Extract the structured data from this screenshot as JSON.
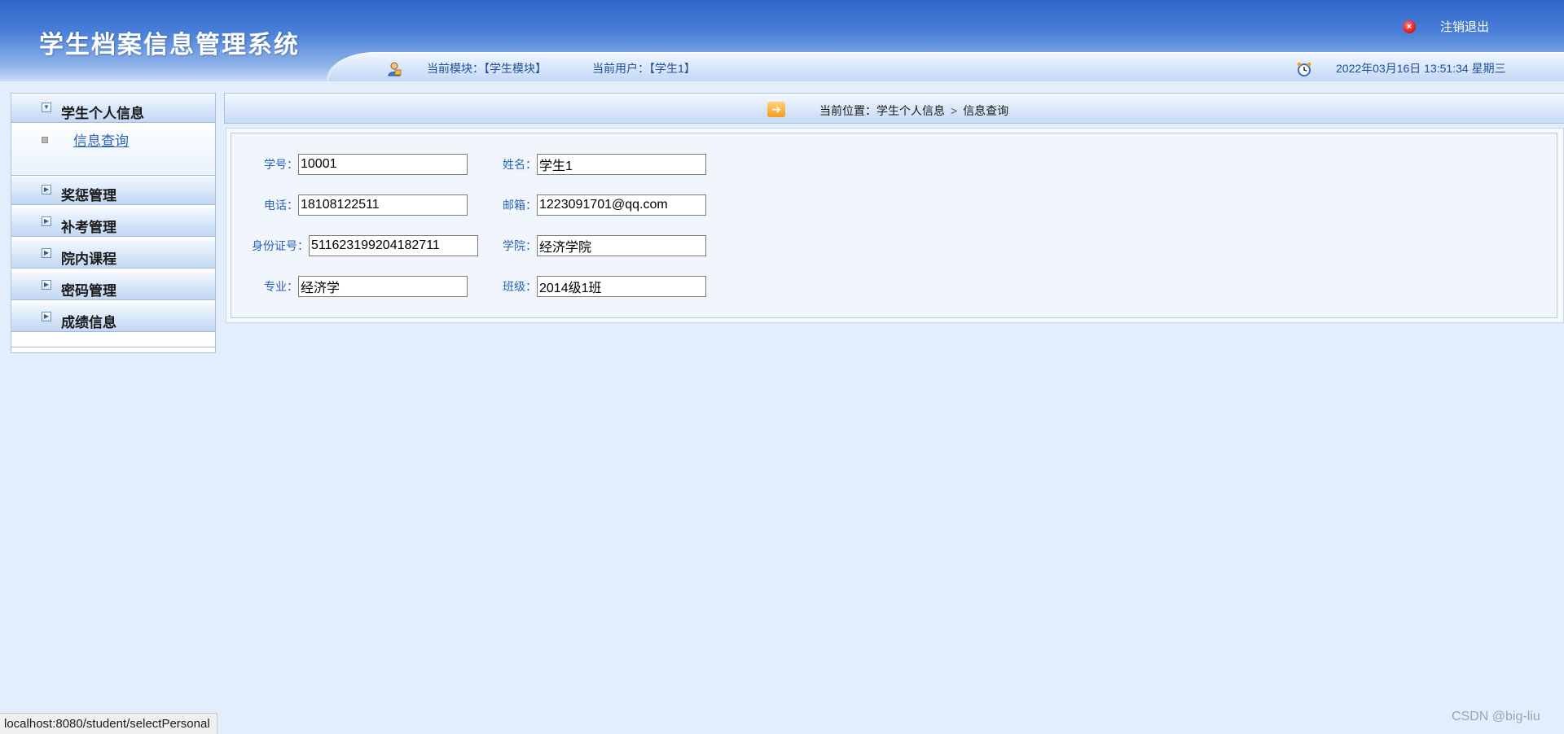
{
  "header": {
    "title": "学生档案信息管理系统",
    "logout_label": "注销退出",
    "module_text": "当前模块：【学生模块】",
    "user_text": "当前用户：【学生1】",
    "datetime_text": "2022年03月16日 13:51:34 星期三"
  },
  "sidebar": {
    "groups": [
      {
        "label": "学生个人信息",
        "expanded": true,
        "items": [
          {
            "label": "信息查询"
          }
        ]
      },
      {
        "label": "奖惩管理",
        "expanded": false
      },
      {
        "label": "补考管理",
        "expanded": false
      },
      {
        "label": "院内课程",
        "expanded": false
      },
      {
        "label": "密码管理",
        "expanded": false
      },
      {
        "label": "成绩信息",
        "expanded": false
      }
    ]
  },
  "breadcrumb": {
    "prefix": "当前位置：学生个人信息",
    "separator": ">",
    "current": "信息查询"
  },
  "form": {
    "student_id": {
      "label": "学号：",
      "value": "10001"
    },
    "name": {
      "label": "姓名：",
      "value": "学生1"
    },
    "phone": {
      "label": "电话：",
      "value": "18108122511"
    },
    "email": {
      "label": "邮箱：",
      "value": "1223091701@qq.com"
    },
    "id_card": {
      "label": "身份证号：",
      "value": "511623199204182711"
    },
    "college": {
      "label": "学院：",
      "value": "经济学院"
    },
    "major": {
      "label": "专业：",
      "value": "经济学"
    },
    "class_name": {
      "label": "班级：",
      "value": "2014级1班"
    }
  },
  "status_bar": {
    "url": "localhost:8080/student/selectPersonal"
  },
  "watermark": "CSDN @big-liu",
  "colors": {
    "header_blue": "#2f66c9",
    "page_background": "#e2eefc",
    "label_blue": "#2a62b8",
    "logout_red": "#e02020",
    "crumb_orange": "#f59b1c"
  },
  "icons": {
    "logout": "close-circle-icon",
    "user": "user-icon",
    "clock": "clock-icon",
    "breadcrumb": "arrow-right-icon",
    "menu_expanded": "collapse-icon",
    "menu_collapsed": "expand-icon",
    "sub_bullet": "bullet-icon"
  }
}
